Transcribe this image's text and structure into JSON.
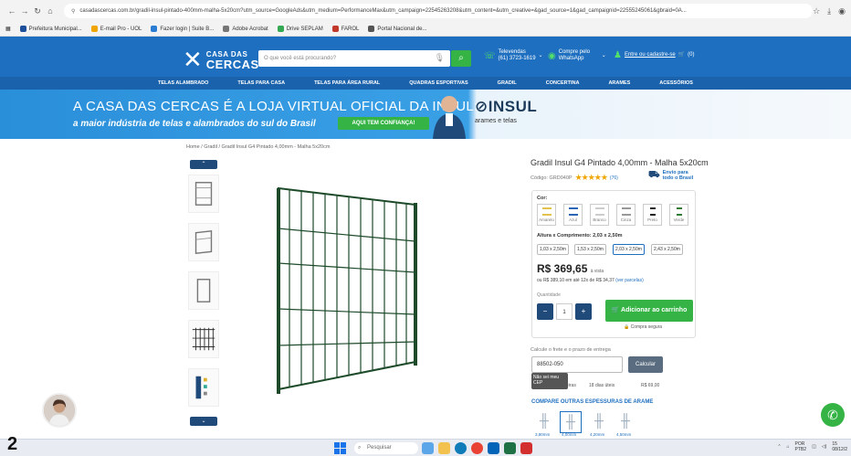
{
  "browser": {
    "url": "casadascercas.com.br/gradil-insul-pintado-400mm-malha-5x20cm?utm_source=GoogleAds&utm_medium=PerformanceMax&utm_campaign=22545263208&utm_content=&utm_creative=&gad_source=1&gad_campaignid=22555245061&gbraid=0A...",
    "bookmarks": [
      "Prefeitura Municipal...",
      "E-mail Pro - UOL",
      "Fazer login | Suite B...",
      "Adobe Acrobat",
      "Drive SEPLAM",
      "FAROL",
      "Portal Nacional de..."
    ]
  },
  "header": {
    "logo_top": "CASA DAS",
    "logo_bottom": "CERCAS",
    "search_placeholder": "O que você está procurando?",
    "televendas_label": "Televendas",
    "televendas_phone": "(61) 3723-1619",
    "whatsapp_label": "Compre pelo WhatsApp",
    "login_text": "Entre ou cadastre-se",
    "cart_count": "(0)",
    "categories": [
      "TELAS ALAMBRADO",
      "TELAS PARA CASA",
      "TELAS PARA ÁREA RURAL",
      "QUADRAS ESPORTIVAS",
      "GRADIL",
      "CONCERTINA",
      "ARAMES",
      "ACESSÓRIOS"
    ]
  },
  "banner": {
    "title": "A CASA DAS CERCAS É A LOJA VIRTUAL OFICIAL DA INSUL:",
    "subtitle": "a maior indústria de telas e alambrados do sul do Brasil",
    "button": "AQUI TEM CONFIANÇA!",
    "brand": "INSUL",
    "brand_tag": "arames e telas"
  },
  "breadcrumb": "Home / Gradil / Gradil Insul G4 Pintado 4,00mm - Malha 5x20cm",
  "product": {
    "title": "Gradil Insul G4 Pintado 4,00mm - Malha 5x20cm",
    "code": "Código: GRD040P",
    "rating": 5,
    "reviews": "(76)",
    "shipping_badge_1": "Envio para",
    "shipping_badge_2": "todo o Brasil",
    "color_label": "Cor:",
    "colors": [
      "Amarelo",
      "Azul",
      "Branco",
      "Cinza",
      "Preto",
      "Verde"
    ],
    "size_label": "Altura x Comprimento: 2,03 x 2,50m",
    "sizes": [
      "1,03 x 2,50m",
      "1,53 x 2,50m",
      "2,03 x 2,50m",
      "2,43 x 2,50m"
    ],
    "selected_size_index": 2,
    "price": "R$ 369,65",
    "price_suffix": "à vista",
    "installment": "ou R$ 389,10 em até 12x de R$ 34,37",
    "installment_link": "(ver parcelas)",
    "qty_label": "Quantidade",
    "qty_value": "1",
    "add_to_cart": "Adicionar ao carrinho",
    "secure": "Compra segura"
  },
  "shipping": {
    "label": "Calcule o frete e o prazo de entrega",
    "cep": "88502-050",
    "calc_button": "Calcular",
    "tooltip": "Não sei meu CEP",
    "rows": [
      "eiras",
      "18 dias úteis",
      "R$ 69,00"
    ]
  },
  "compare": {
    "title": "COMPARE OUTRAS ESPESSURAS DE ARAME",
    "options": [
      "3,80mm",
      "4,00mm",
      "4,20mm",
      "4,50mm"
    ],
    "selected_index": 1
  },
  "taskbar": {
    "leading_number": "2",
    "search": "Pesquisar",
    "lang_1": "POR",
    "lang_2": "PTB2",
    "time": "15",
    "date": "08/12/2"
  },
  "colors": {
    "brand_blue": "#1e6fbf",
    "green": "#35b445",
    "dark_blue": "#1f4a7a"
  }
}
